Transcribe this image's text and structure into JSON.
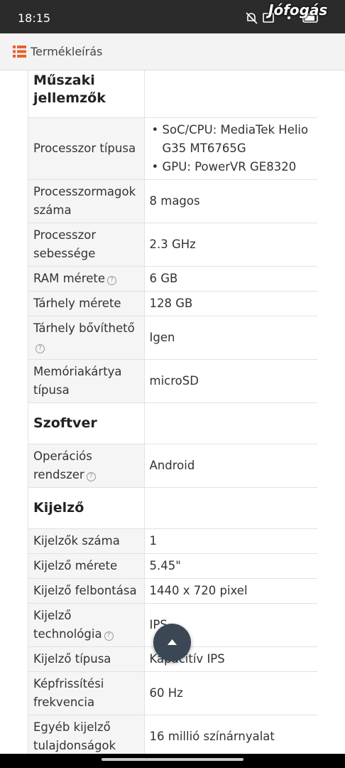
{
  "status_bar": {
    "time": "18:15",
    "brand": "Jófogás",
    "icons": [
      "bell-off-icon",
      "image-icon",
      "notification-icon",
      "battery-icon"
    ]
  },
  "header": {
    "icon": "list-icon",
    "title": "Termékleírás"
  },
  "spec_table": {
    "rows": [
      {
        "type": "section",
        "label": "Műszaki jellemzők"
      },
      {
        "type": "spec",
        "label": "Processzor típusa",
        "bullets": [
          "SoC/CPU: MediaTek Helio G35 MT6765G",
          "GPU: PowerVR GE8320"
        ]
      },
      {
        "type": "spec",
        "label": "Processzormagok száma",
        "value": "8 magos"
      },
      {
        "type": "spec",
        "label": "Processzor sebessége",
        "value": "2.3 GHz"
      },
      {
        "type": "spec",
        "label": "RAM mérete",
        "value": "6 GB",
        "help": true
      },
      {
        "type": "spec",
        "label": "Tárhely mérete",
        "value": "128 GB"
      },
      {
        "type": "spec",
        "label": "Tárhely bővíthető",
        "value": "Igen",
        "help": true
      },
      {
        "type": "spec",
        "label": "Memóriakártya típusa",
        "value": "microSD"
      },
      {
        "type": "section",
        "label": "Szoftver"
      },
      {
        "type": "spec",
        "label": "Operációs rendszer",
        "value": "Android",
        "help": true
      },
      {
        "type": "section",
        "label": "Kijelző"
      },
      {
        "type": "spec",
        "label": "Kijelzők száma",
        "value": "1"
      },
      {
        "type": "spec",
        "label": "Kijelző mérete",
        "value": "5.45\""
      },
      {
        "type": "spec",
        "label": "Kijelző felbontása",
        "value": "1440 x 720 pixel"
      },
      {
        "type": "spec",
        "label": "Kijelző technológia",
        "value": "IPS",
        "help": true
      },
      {
        "type": "spec",
        "label": "Kijelző típusa",
        "value": "Kapacitív IPS"
      },
      {
        "type": "spec",
        "label": "Képfrissítési frekvencia",
        "value": "60 Hz"
      },
      {
        "type": "spec",
        "label": "Egyéb kijelző tulajdonságok",
        "value": "16 millió színárnyalat"
      }
    ]
  },
  "help_glyph": "?",
  "scroll_top_button": {
    "icon": "arrow-up-icon"
  },
  "colors": {
    "status_bar": "#2b2b2b",
    "header_bg": "#f3f3f3",
    "list_icon": "#e8612c",
    "fab": "#3c4756"
  }
}
